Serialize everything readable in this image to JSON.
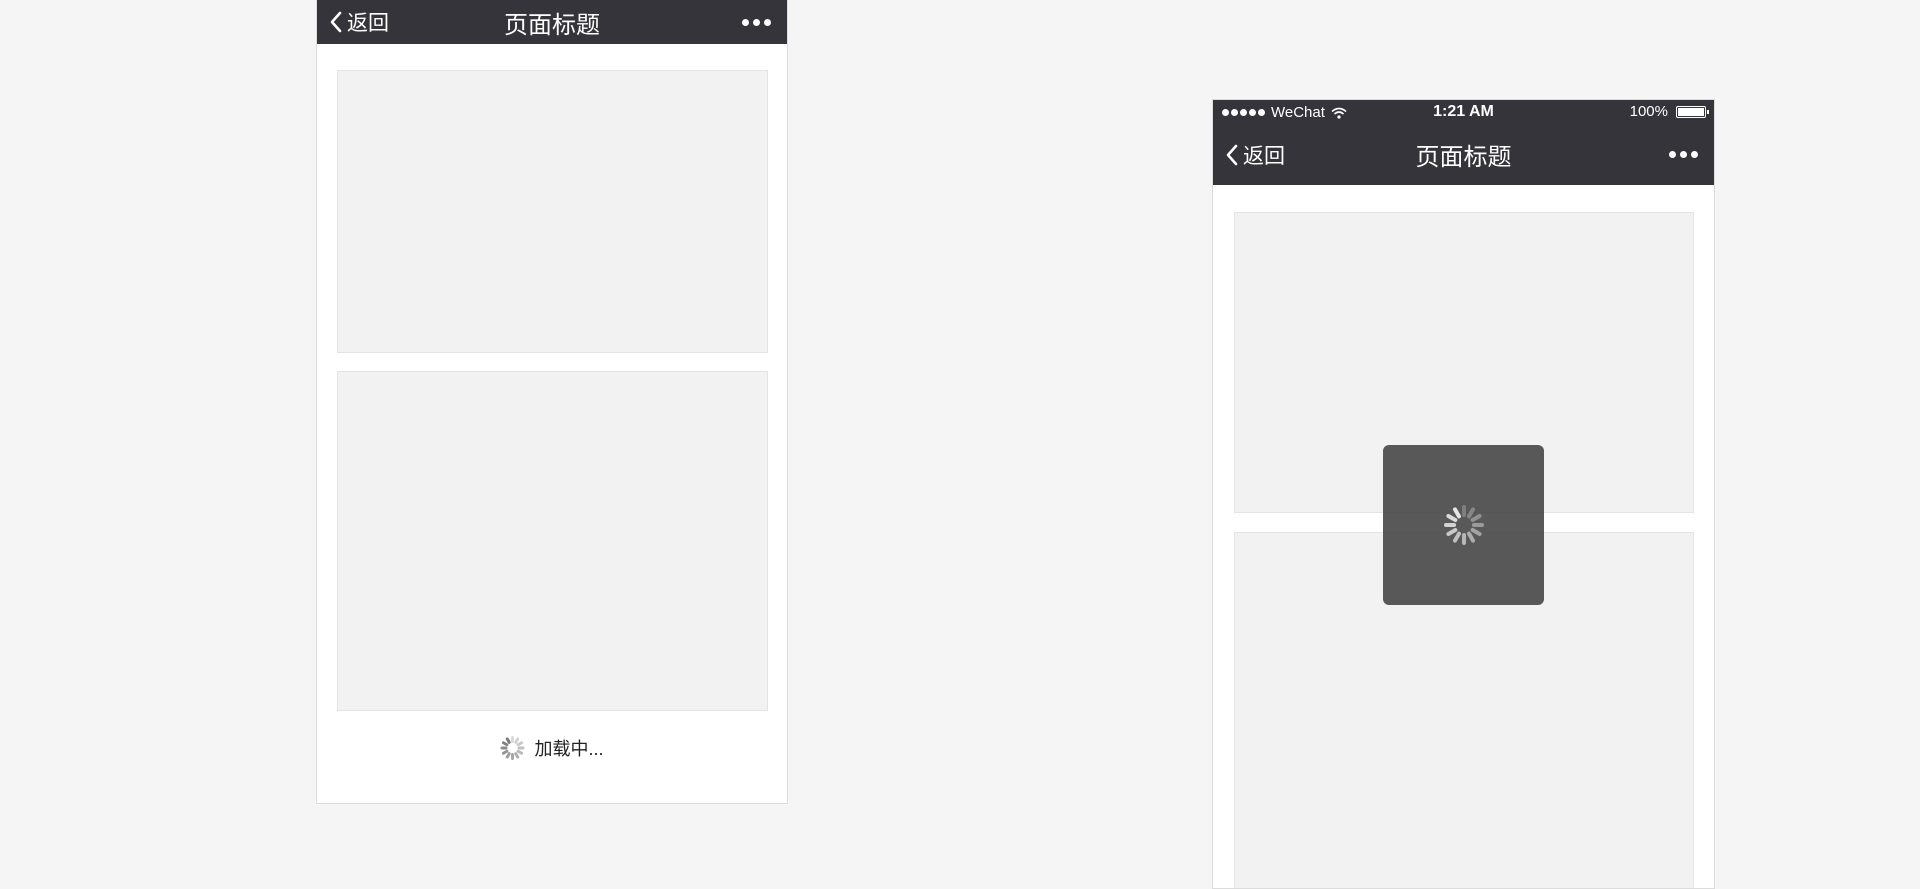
{
  "left_phone": {
    "navbar": {
      "back_label": "返回",
      "title": "页面标题"
    },
    "loadmore": {
      "text": "加载中..."
    }
  },
  "right_phone": {
    "statusbar": {
      "carrier": "WeChat",
      "time": "1:21 AM",
      "battery": "100%"
    },
    "navbar": {
      "back_label": "返回",
      "title": "页面标题"
    }
  },
  "colors": {
    "navbar_bg": "#35343a",
    "page_bg": "#f5f5f5",
    "card_bg": "#f2f2f2",
    "toast_bg": "#424242"
  },
  "icons": [
    "chevron-left-icon",
    "more-icon",
    "signal-icon",
    "wifi-icon",
    "battery-icon",
    "spinner-icon"
  ]
}
